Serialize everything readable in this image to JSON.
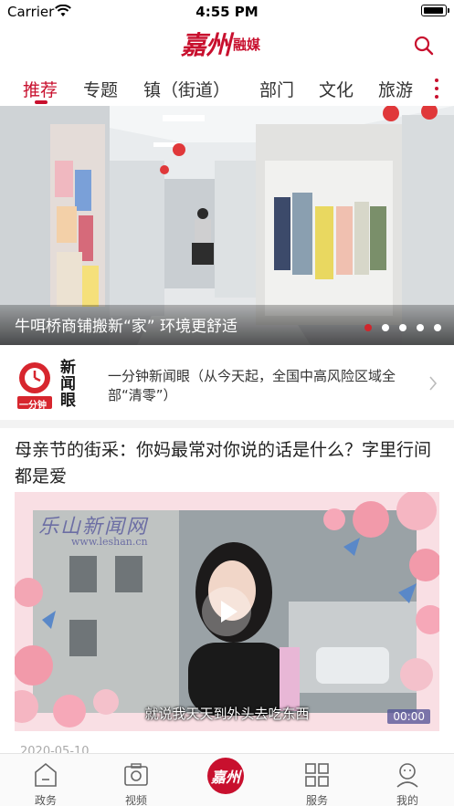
{
  "status_bar": {
    "carrier": "Carrier",
    "time": "4:55 PM"
  },
  "header": {
    "logo_main": "嘉州",
    "logo_sub": "融媒"
  },
  "tabs": [
    {
      "label": "推荐",
      "active": true
    },
    {
      "label": "专题"
    },
    {
      "label": "镇（街道）"
    },
    {
      "label": "部门"
    },
    {
      "label": "文化"
    },
    {
      "label": "旅游"
    }
  ],
  "banner": {
    "caption": "牛咡桥商铺搬新“家” 环境更舒适",
    "dots_total": 5,
    "active_dot": 1
  },
  "news_eye": {
    "logo_title": "新闻眼",
    "logo_sub": "一分钟",
    "text": "一分钟新闻眼（从今天起，全国中高风险区域全部“清零”）"
  },
  "article": {
    "title": "母亲节的街采：你妈最常对你说的话是什么？字里行间都是爱",
    "watermark": "乐山新闻网",
    "watermark_url": "www.leshan.cn",
    "subtitle": "就说我天天到外头去吃东西",
    "duration": "00:00",
    "date": "2020-05-10"
  },
  "bottom_tabs": [
    {
      "label": "政务",
      "icon": "house-icon"
    },
    {
      "label": "视频",
      "icon": "camera-icon"
    },
    {
      "label": "",
      "icon": "center-logo",
      "logo_text": "嘉州"
    },
    {
      "label": "服务",
      "icon": "grid-icon"
    },
    {
      "label": "我的",
      "icon": "user-icon"
    }
  ],
  "colors": {
    "accent": "#c8102e",
    "tab_text": "#333333"
  }
}
